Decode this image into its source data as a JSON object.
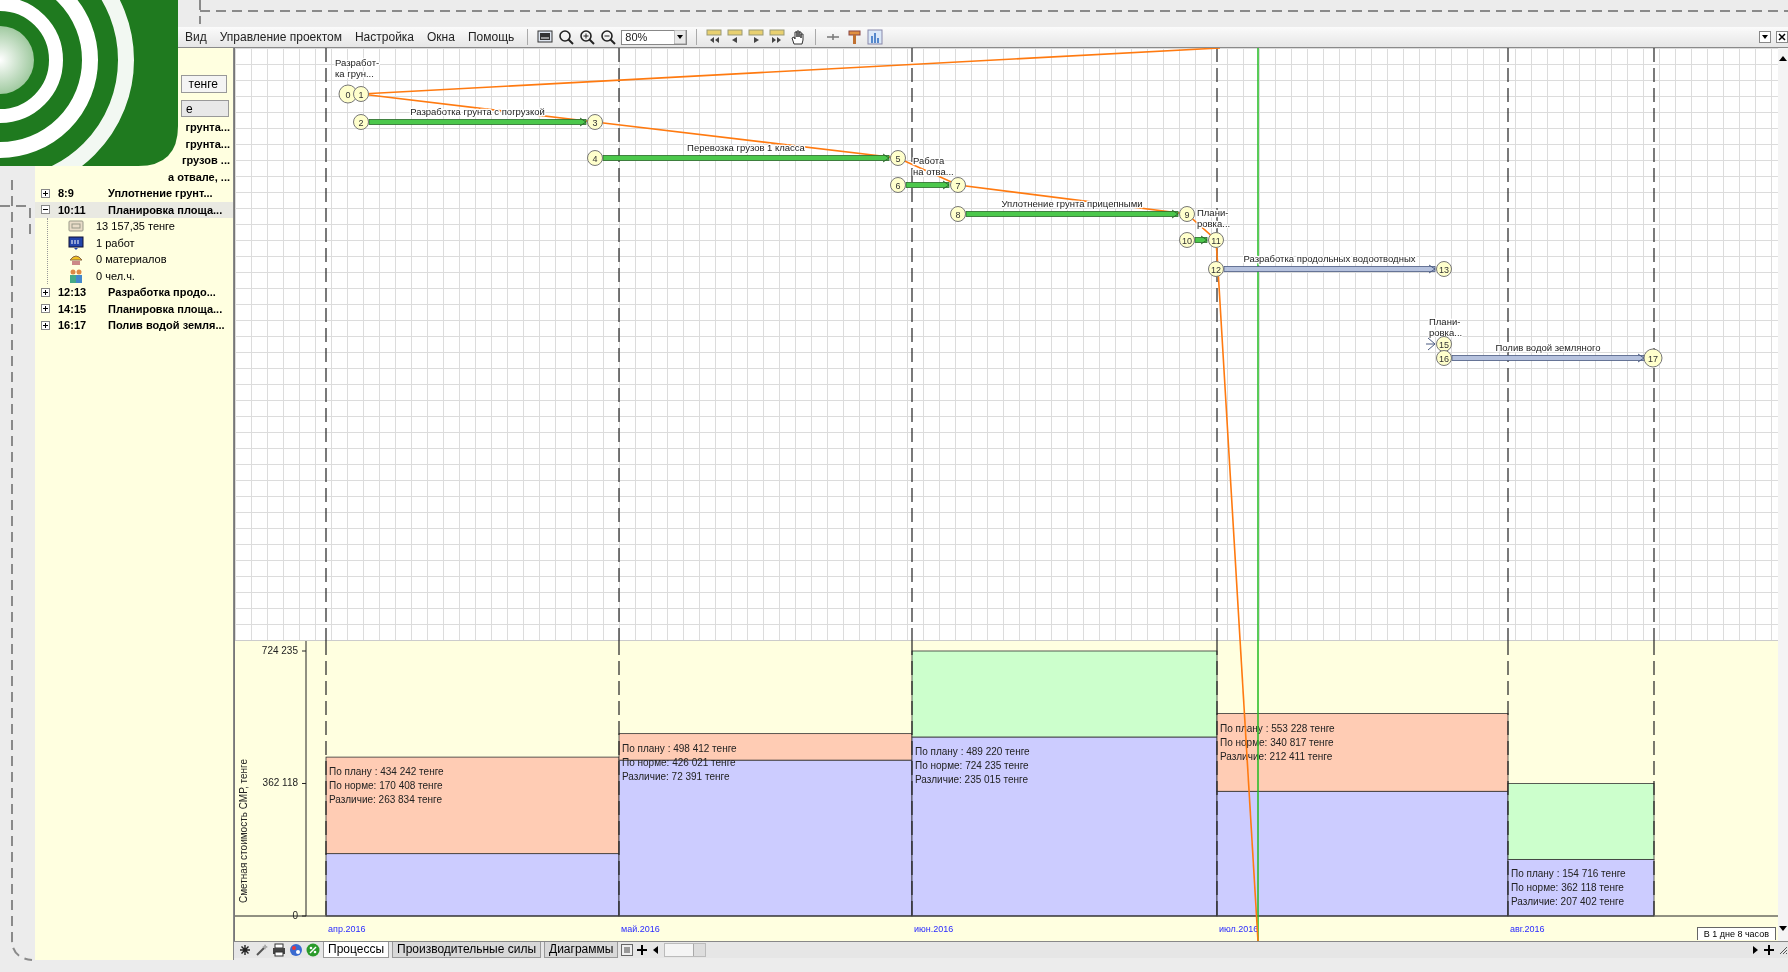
{
  "menu": [
    {
      "label": "Вид"
    },
    {
      "label": "Управление проектом"
    },
    {
      "label": "Настройка"
    },
    {
      "label": "Окна"
    },
    {
      "label": "Помощь"
    }
  ],
  "toolbar": {
    "zoom": "80%"
  },
  "tree": {
    "header_button": "тенге",
    "header_field": "е",
    "rows": [
      {
        "kind": "clipped",
        "name": "грунта...",
        "selected": false
      },
      {
        "kind": "clipped",
        "name": "грунта...",
        "selected": false
      },
      {
        "kind": "clipped",
        "name": "грузов ...",
        "selected": false
      },
      {
        "kind": "clipped",
        "name": "а отвале, ...",
        "selected": false
      },
      {
        "kind": "task",
        "code": "8:9",
        "name": "Уплотнение грунт...",
        "expanded": false,
        "selected": false
      },
      {
        "kind": "task",
        "code": "10:11",
        "name": "Планировка площа...",
        "expanded": true,
        "selected": true,
        "children": [
          {
            "kind": "cost",
            "text": "13 157,35 тенге"
          },
          {
            "kind": "works",
            "text": "1 работ"
          },
          {
            "kind": "materials",
            "text": "0 материалов"
          },
          {
            "kind": "labor",
            "text": "0 чел.ч."
          }
        ]
      },
      {
        "kind": "task",
        "code": "12:13",
        "name": "Разработка продо...",
        "expanded": false,
        "selected": false
      },
      {
        "kind": "task",
        "code": "14:15",
        "name": "Планировка площа...",
        "expanded": false,
        "selected": false
      },
      {
        "kind": "task",
        "code": "16:17",
        "name": "Полив водой земля...",
        "expanded": false,
        "selected": false
      }
    ]
  },
  "diagram": {
    "nodes": [
      {
        "number": "0"
      },
      {
        "number": "1"
      },
      {
        "number": "2"
      },
      {
        "number": "3"
      },
      {
        "number": "4"
      },
      {
        "number": "5"
      },
      {
        "number": "6"
      },
      {
        "number": "7"
      },
      {
        "number": "8"
      },
      {
        "number": "9"
      },
      {
        "number": "10"
      },
      {
        "number": "11"
      },
      {
        "number": "12"
      },
      {
        "number": "13"
      },
      {
        "number": "15"
      },
      {
        "number": "16"
      },
      {
        "number": "17"
      }
    ],
    "activities": [
      {
        "kind": "done",
        "label": "Разработка грунта с погрузкой"
      },
      {
        "kind": "done",
        "label": "Перевозка грузов 1 класса"
      },
      {
        "kind": "done"
      },
      {
        "kind": "done",
        "label": "Уплотнение грунта прицепными"
      },
      {
        "kind": "done"
      },
      {
        "kind": "planned",
        "label": "Разработка продольных водоотводных"
      },
      {
        "kind": "planned",
        "label": "Полив водой земляного"
      }
    ],
    "captions": [
      {
        "lines": [
          "Разработ-",
          "ка грун..."
        ]
      },
      {
        "lines": [
          "Работа",
          "на отва..."
        ]
      },
      {
        "lines": [
          "Плани-",
          "ровка..."
        ]
      },
      {
        "lines": [
          "Плани-",
          "ровка..."
        ]
      }
    ]
  },
  "chart": {
    "chart_data": {
      "type": "bar",
      "stacked": true,
      "ylabel": "Сметная стоимость СМР, тенге",
      "categories": [
        "апр.2016",
        "май.2016",
        "июн.2016",
        "июл.2016",
        "авг.2016"
      ],
      "series": [
        {
          "color": "#ccccff",
          "values": [
            170408,
            426021,
            489220,
            340817,
            154716
          ]
        },
        {
          "color": "#ffccb4",
          "values": [
            263834,
            72391,
            0,
            212411,
            0
          ]
        },
        {
          "color": "#ccffcc",
          "values": [
            0,
            0,
            235015,
            0,
            207402
          ]
        }
      ],
      "ylim": [
        0,
        724235
      ],
      "yticks": [
        {
          "value": 0,
          "label": "0"
        },
        {
          "value": 362118,
          "label": "362 118"
        },
        {
          "value": 724235,
          "label": "724 235"
        }
      ],
      "annotations": [
        {
          "text": "По плану : 434 242 тенге"
        },
        {
          "text": "По норме: 170 408 тенге"
        },
        {
          "text": "Различие: 263 834 тенге"
        },
        {
          "text": "По плану : 498 412 тенге"
        },
        {
          "text": "По норме: 426 021 тенге"
        },
        {
          "text": "Различие: 72 391 тенге"
        },
        {
          "text": "По плану : 489 220 тенге"
        },
        {
          "text": "По норме: 724 235 тенге"
        },
        {
          "text": "Различие: 235 015 тенге"
        },
        {
          "text": "По плану : 553 228 тенге"
        },
        {
          "text": "По норме: 340 817 тенге"
        },
        {
          "text": "Различие: 212 411 тенге"
        },
        {
          "text": "По плану : 154 716 тенге"
        },
        {
          "text": "По норме: 362 118 тенге"
        },
        {
          "text": "Различие: 207 402 тенге"
        }
      ]
    },
    "scale_label": "В 1 дне 8 часов"
  },
  "sheet_tabs": [
    {
      "label": "Процессы",
      "selected": true
    },
    {
      "label": "Производительные силы",
      "selected": false
    },
    {
      "label": "Диаграммы",
      "selected": false
    }
  ]
}
